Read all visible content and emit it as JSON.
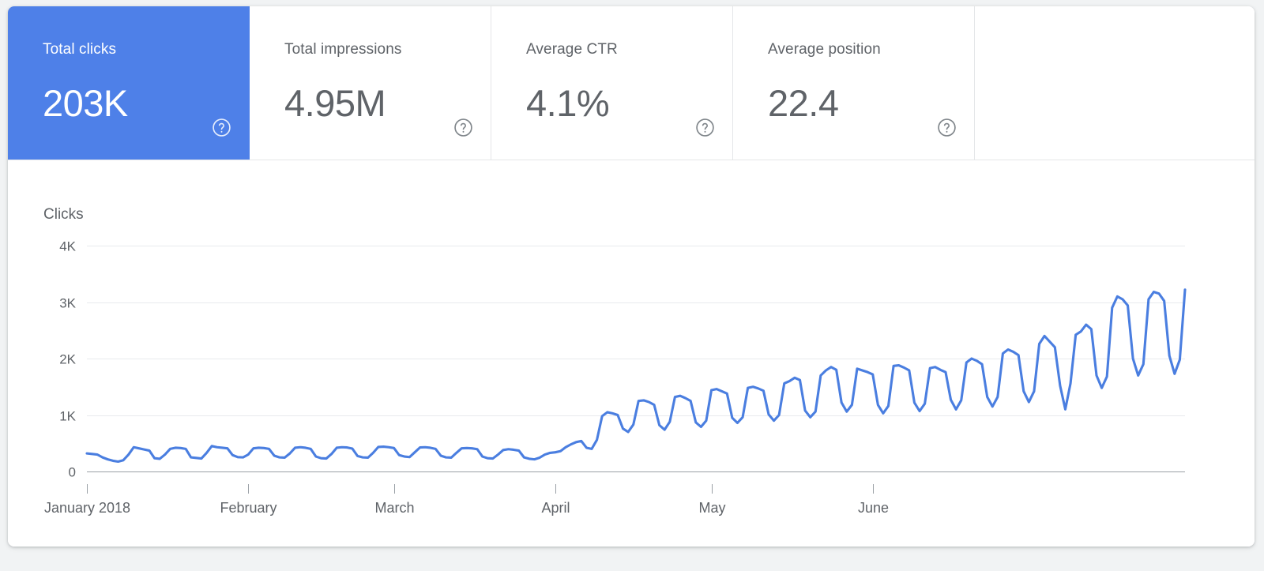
{
  "metrics": {
    "cards": [
      {
        "label": "Total clicks",
        "value": "203K",
        "active": true,
        "help_icon": "help-circle-icon"
      },
      {
        "label": "Total impressions",
        "value": "4.95M",
        "active": false,
        "help_icon": "help-circle-icon"
      },
      {
        "label": "Average CTR",
        "value": "4.1%",
        "active": false,
        "help_icon": "help-circle-icon"
      },
      {
        "label": "Average position",
        "value": "22.4",
        "active": false,
        "help_icon": "help-circle-icon"
      }
    ]
  },
  "colors": {
    "active_card_bg": "#4e80e8",
    "line": "#4a7ee0",
    "label_text": "#5f6368",
    "gridline": "#e8eaed",
    "axis": "#9aa0a6",
    "panel_bg": "#ffffff",
    "page_bg": "#f1f3f4"
  },
  "chart_data": {
    "type": "line",
    "title": "",
    "series_label": "Clicks",
    "xlabel": "",
    "ylabel": "Clicks",
    "ylim": [
      0,
      4000
    ],
    "yticks": [
      0,
      1000,
      2000,
      3000,
      4000
    ],
    "ytick_labels": [
      "0",
      "1K",
      "2K",
      "3K",
      "4K"
    ],
    "xtick_labels": [
      "January 2018",
      "February",
      "March",
      "April",
      "May",
      "June"
    ],
    "xtick_indices": [
      0,
      31,
      59,
      90,
      120,
      151
    ],
    "grid": true,
    "legend": "none",
    "x_start": "2018-01-01",
    "x_end": "2018-06-30",
    "series": [
      {
        "name": "Clicks",
        "color": "#4a7ee0",
        "values": [
          320,
          310,
          300,
          250,
          215,
          190,
          175,
          200,
          300,
          430,
          410,
          390,
          370,
          235,
          225,
          300,
          400,
          420,
          415,
          400,
          250,
          240,
          230,
          330,
          450,
          430,
          420,
          410,
          290,
          255,
          250,
          300,
          410,
          420,
          415,
          400,
          280,
          250,
          245,
          320,
          420,
          430,
          420,
          400,
          265,
          235,
          230,
          310,
          420,
          430,
          425,
          405,
          275,
          250,
          245,
          330,
          435,
          440,
          430,
          415,
          290,
          265,
          255,
          340,
          425,
          430,
          420,
          400,
          280,
          250,
          245,
          330,
          410,
          415,
          410,
          395,
          265,
          235,
          230,
          300,
          380,
          395,
          385,
          370,
          250,
          225,
          215,
          245,
          300,
          330,
          340,
          360,
          430,
          480,
          520,
          540,
          420,
          400,
          560,
          980,
          1050,
          1030,
          1000,
          760,
          700,
          830,
          1250,
          1260,
          1230,
          1180,
          820,
          740,
          880,
          1320,
          1340,
          1300,
          1250,
          870,
          790,
          900,
          1440,
          1460,
          1420,
          1380,
          950,
          860,
          960,
          1480,
          1500,
          1470,
          1430,
          1010,
          900,
          1000,
          1560,
          1600,
          1660,
          1620,
          1080,
          960,
          1060,
          1700,
          1790,
          1850,
          1800,
          1220,
          1060,
          1180,
          1820,
          1790,
          1760,
          1720,
          1180,
          1030,
          1160,
          1870,
          1880,
          1840,
          1790,
          1220,
          1070,
          1200,
          1830,
          1850,
          1800,
          1760,
          1270,
          1100,
          1260,
          1930,
          2000,
          1960,
          1900,
          1320,
          1150,
          1320,
          2090,
          2160,
          2120,
          2060,
          1420,
          1230,
          1420,
          2260,
          2400,
          2300,
          2200,
          1520,
          1100,
          1560,
          2420,
          2480,
          2600,
          2520,
          1700,
          1480,
          1680,
          2900,
          3100,
          3050,
          2940,
          2000,
          1700,
          1900,
          3050,
          3180,
          3150,
          3020,
          2050,
          1730,
          1980,
          3220
        ]
      }
    ]
  }
}
